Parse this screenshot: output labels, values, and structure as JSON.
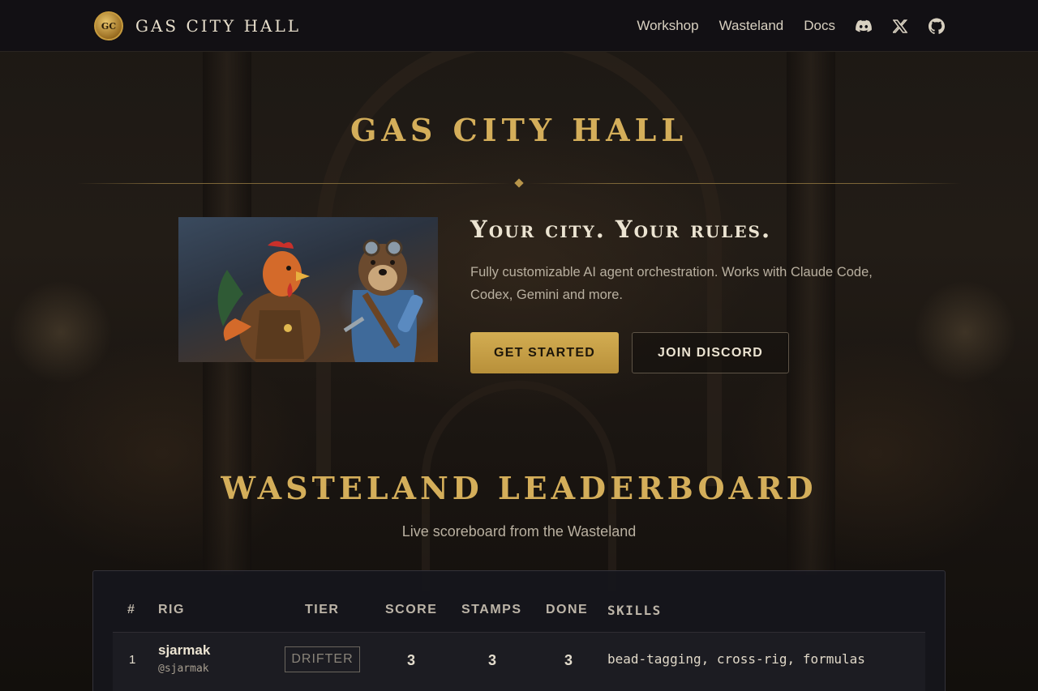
{
  "nav": {
    "logo_text": "GC",
    "brand": "GAS CITY HALL",
    "links": [
      "Workshop",
      "Wasteland",
      "Docs"
    ],
    "icons": [
      "discord-icon",
      "x-icon",
      "github-icon"
    ]
  },
  "hero": {
    "title": "GAS CITY HALL",
    "tagline": "Your city. Your rules.",
    "description": "Fully customizable AI agent orchestration. Works with Claude Code, Codex, Gemini and more.",
    "primary_button": "GET STARTED",
    "secondary_button": "JOIN DISCORD"
  },
  "leaderboard": {
    "title": "WASTELAND LEADERBOARD",
    "subtitle": "Live scoreboard from the Wasteland",
    "columns": [
      "#",
      "RIG",
      "TIER",
      "SCORE",
      "STAMPS",
      "DONE",
      "SKILLS"
    ],
    "rows": [
      {
        "rank": "1",
        "name": "sjarmak",
        "handle": "@sjarmak",
        "tier": "DRIFTER",
        "score": "3",
        "stamps": "3",
        "done": "3",
        "skills": "bead-tagging, cross-rig, formulas"
      }
    ]
  },
  "colors": {
    "accent_gold": "#d4ae5a",
    "nav_bg": "#121014",
    "panel_bg": "#16161c"
  }
}
